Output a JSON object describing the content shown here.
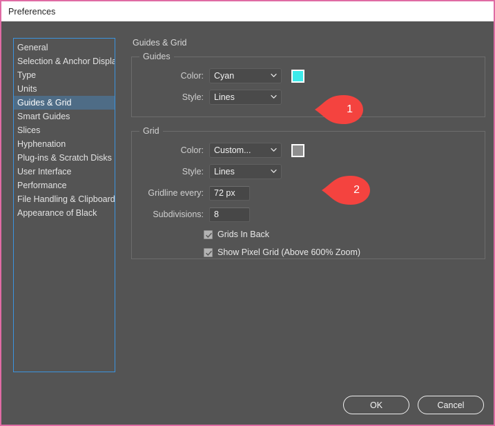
{
  "window": {
    "title": "Preferences",
    "border_color": "#e06ba4",
    "background": "#545454"
  },
  "sidebar": {
    "items": [
      {
        "label": "General",
        "selected": false
      },
      {
        "label": "Selection & Anchor Display",
        "selected": false
      },
      {
        "label": "Type",
        "selected": false
      },
      {
        "label": "Units",
        "selected": false
      },
      {
        "label": "Guides & Grid",
        "selected": true
      },
      {
        "label": "Smart Guides",
        "selected": false
      },
      {
        "label": "Slices",
        "selected": false
      },
      {
        "label": "Hyphenation",
        "selected": false
      },
      {
        "label": "Plug-ins & Scratch Disks",
        "selected": false
      },
      {
        "label": "User Interface",
        "selected": false
      },
      {
        "label": "Performance",
        "selected": false
      },
      {
        "label": "File Handling & Clipboard",
        "selected": false
      },
      {
        "label": "Appearance of Black",
        "selected": false
      }
    ],
    "selected_color": "#4e6c86",
    "focus_border": "#3b94e0"
  },
  "pane": {
    "title": "Guides & Grid"
  },
  "guides": {
    "legend": "Guides",
    "color_label": "Color:",
    "color_value": "Cyan",
    "color_swatch": "#3ceaea",
    "style_label": "Style:",
    "style_value": "Lines"
  },
  "grid": {
    "legend": "Grid",
    "color_label": "Color:",
    "color_value": "Custom...",
    "color_swatch": "#8f8f8f",
    "style_label": "Style:",
    "style_value": "Lines",
    "gridline_label": "Gridline every:",
    "gridline_value": "72 px",
    "subdivisions_label": "Subdivisions:",
    "subdivisions_value": "8",
    "grids_in_back_label": "Grids In Back",
    "grids_in_back_checked": true,
    "show_pixel_grid_label": "Show Pixel Grid (Above 600% Zoom)",
    "show_pixel_grid_checked": true
  },
  "callouts": [
    {
      "number": "1",
      "color": "#f4433f"
    },
    {
      "number": "2",
      "color": "#f4433f"
    }
  ],
  "footer": {
    "ok_label": "OK",
    "cancel_label": "Cancel"
  }
}
